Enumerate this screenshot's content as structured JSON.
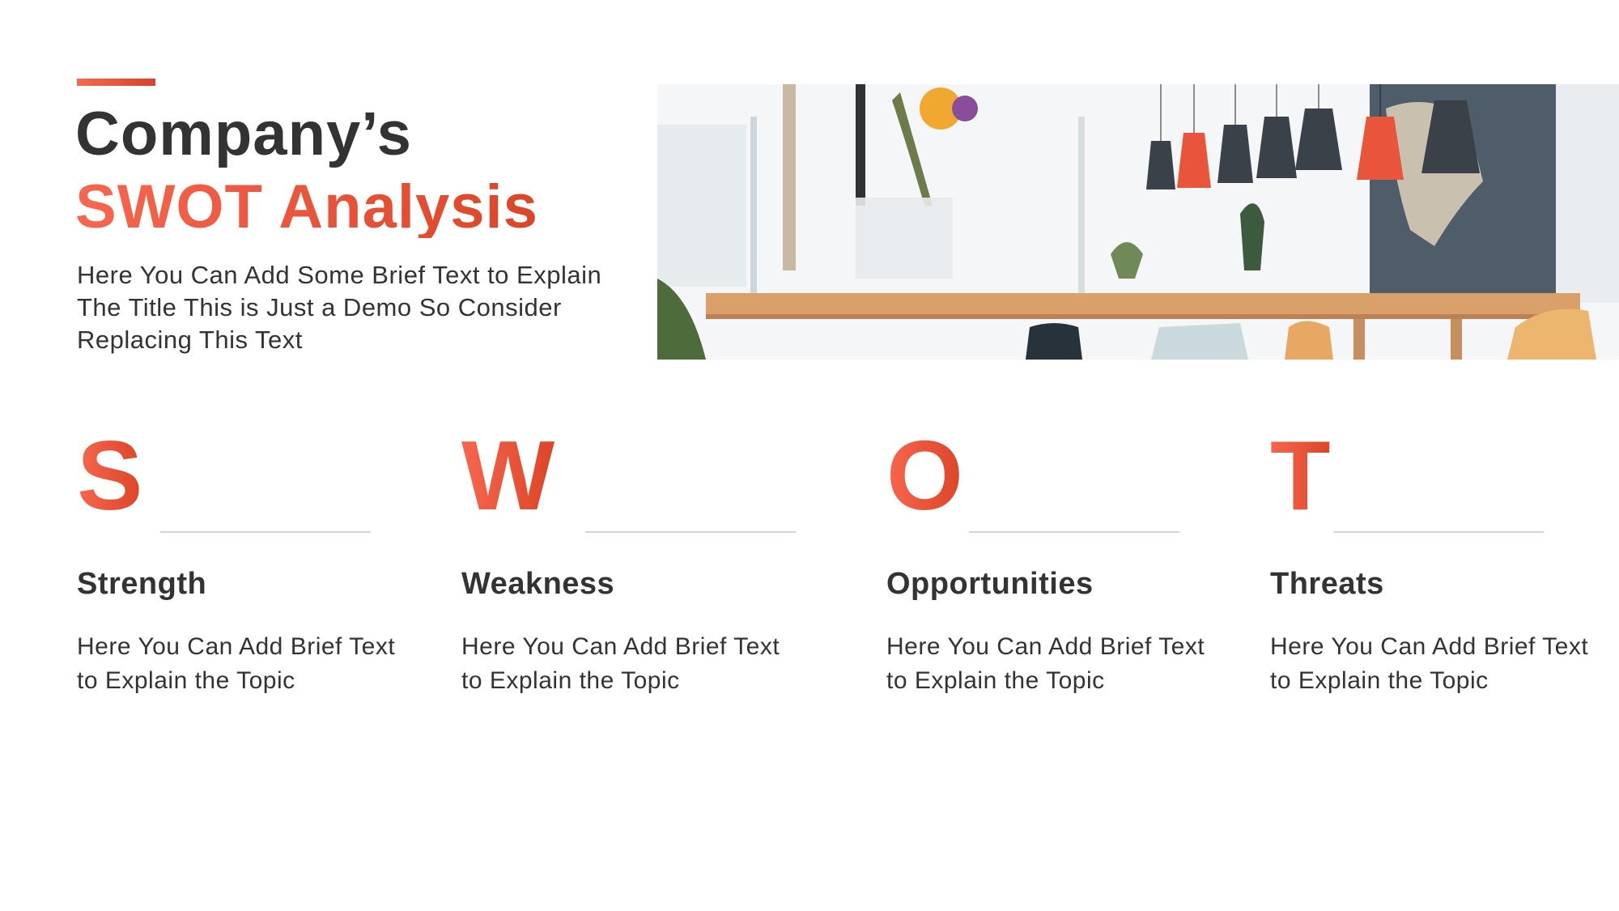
{
  "header": {
    "title_line1": "Company’s",
    "title_line2": "SWOT Analysis",
    "intro": "Here You Can Add Some Brief Text to Explain The Title This is Just a Demo So Consider Replacing This Text"
  },
  "photo": {
    "description": "cafe interior with pendant lamps, flowers and wooden table"
  },
  "colors": {
    "accent_start": "#f7664f",
    "accent_end": "#dc4527",
    "text": "#333333",
    "divider": "#d4d4d4"
  },
  "swot": [
    {
      "letter": "S",
      "title": "Strength",
      "text": "Here You Can Add Brief Text to Explain the Topic"
    },
    {
      "letter": "W",
      "title": "Weakness",
      "text": "Here You Can Add Brief Text to Explain the Topic"
    },
    {
      "letter": "O",
      "title": "Opportunities",
      "text": "Here You Can Add Brief Text to Explain the Topic"
    },
    {
      "letter": "T",
      "title": "Threats",
      "text": "Here You Can Add Brief Text to Explain the Topic"
    }
  ]
}
